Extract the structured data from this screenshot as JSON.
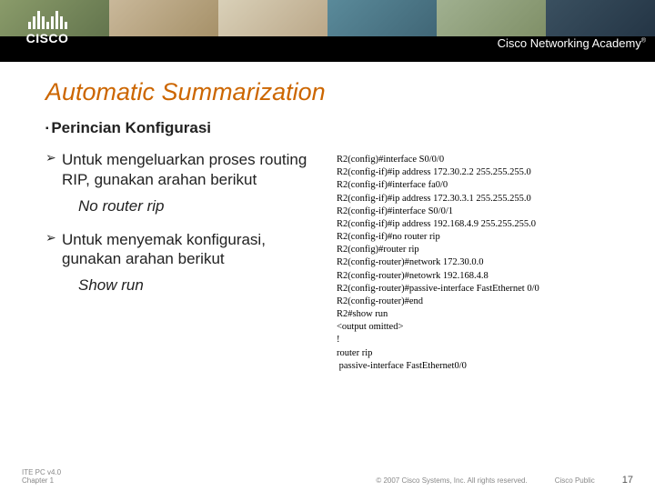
{
  "header": {
    "logo_text": "CISCO",
    "academy_text": "Cisco Networking Academy"
  },
  "slide": {
    "title": "Automatic Summarization",
    "subtitle": "Perincian Konfigurasi",
    "bullet1": "Untuk mengeluarkan proses routing RIP, gunakan arahan berikut",
    "cmd1": "No router rip",
    "bullet2": "Untuk menyemak konfigurasi, gunakan arahan berikut",
    "cmd2": "Show run"
  },
  "cli": {
    "lines": "R2(config)#interface S0/0/0\nR2(config-if)#ip address 172.30.2.2 255.255.255.0\nR2(config-if)#interface fa0/0\nR2(config-if)#ip address 172.30.3.1 255.255.255.0\nR2(config-if)#interface S0/0/1\nR2(config-if)#ip address 192.168.4.9 255.255.255.0\nR2(config-if)#no router rip\nR2(config)#router rip\nR2(config-router)#network 172.30.0.0\nR2(config-router)#netowrk 192.168.4.8\nR2(config-router)#passive-interface FastEthernet 0/0\nR2(config-router)#end\nR2#show run\n<output omitted>\n!\nrouter rip\n passive-interface FastEthernet0/0"
  },
  "footer": {
    "left_line1": "ITE PC v4.0",
    "left_line2": "Chapter 1",
    "copyright": "© 2007 Cisco Systems, Inc. All rights reserved.",
    "label": "Cisco Public",
    "page": "17"
  }
}
